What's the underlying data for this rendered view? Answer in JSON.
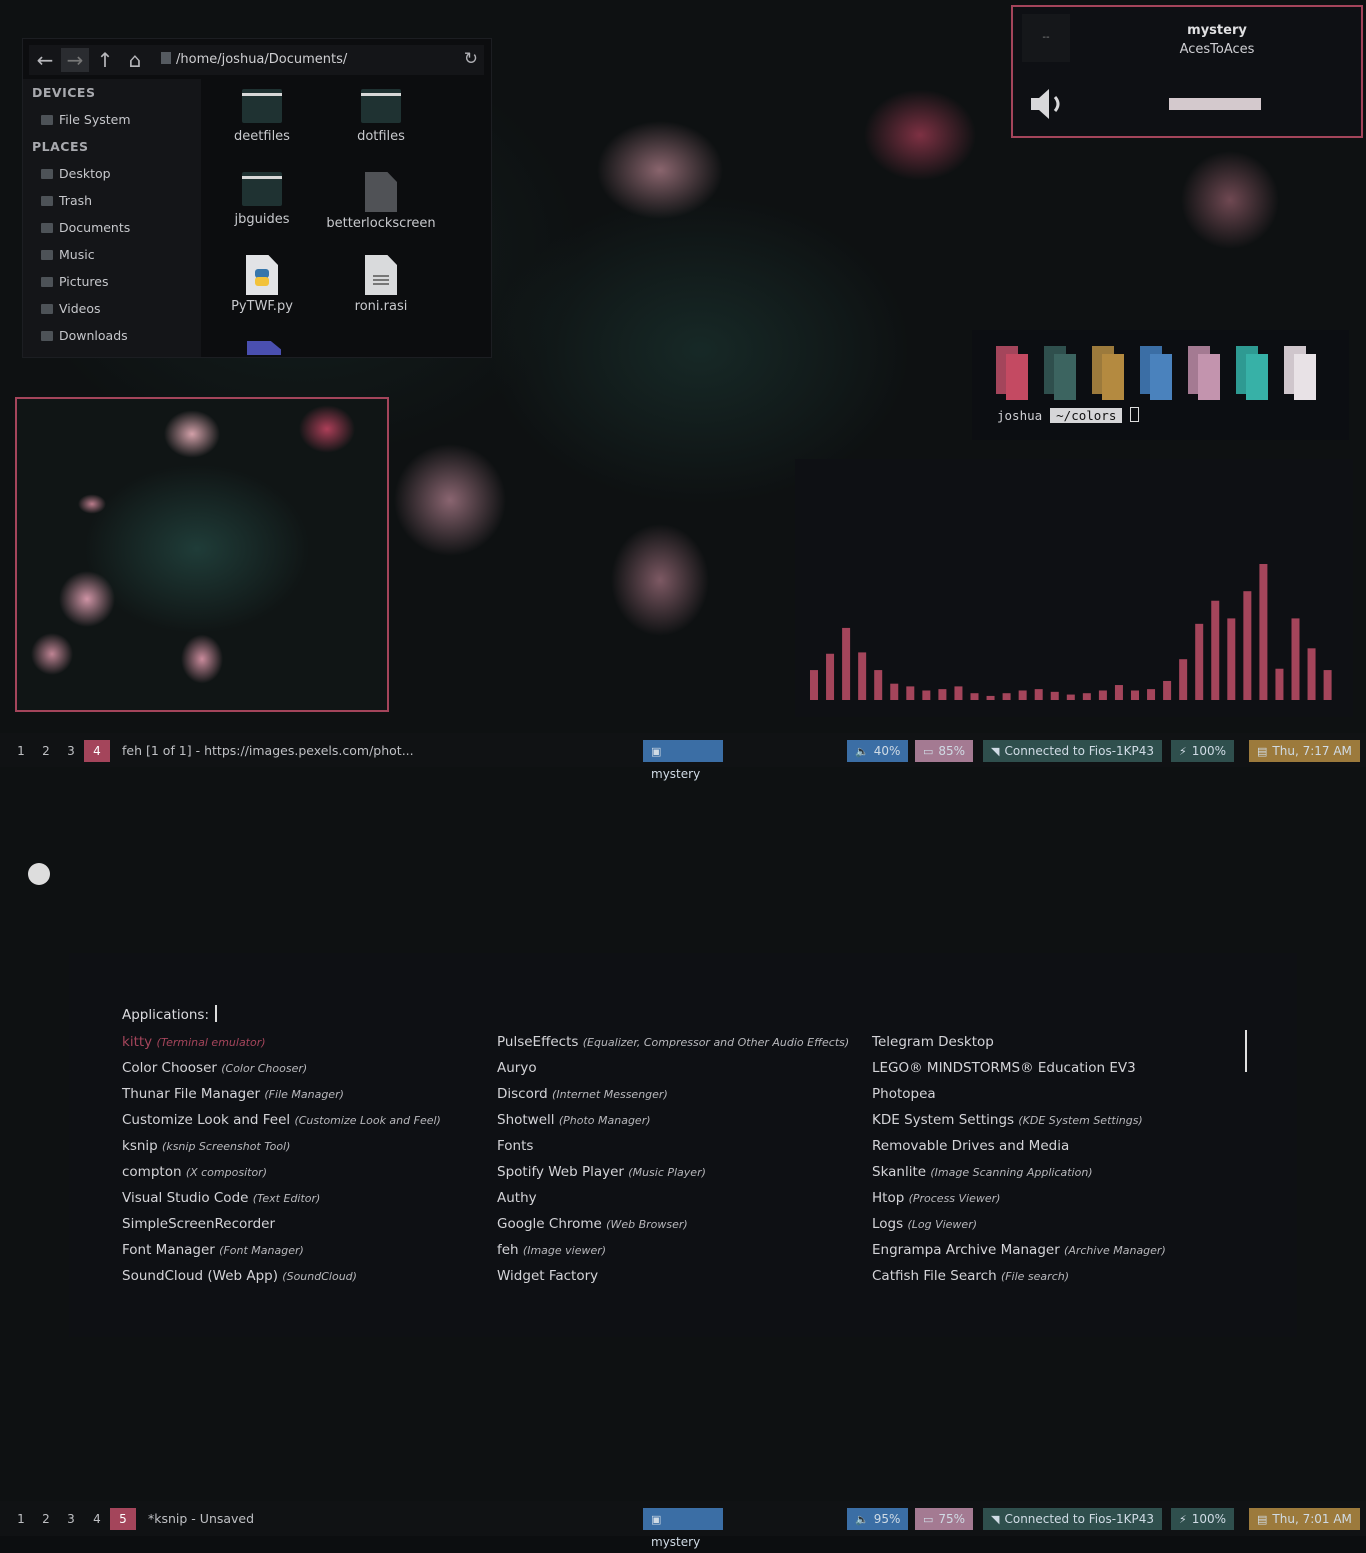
{
  "file_manager": {
    "path": "/home/joshua/Documents/",
    "sections": [
      {
        "title": "DEVICES",
        "items": [
          "File System"
        ]
      },
      {
        "title": "PLACES",
        "items": [
          "Desktop",
          "Trash",
          "Documents",
          "Music",
          "Pictures",
          "Videos",
          "Downloads"
        ]
      }
    ],
    "files": [
      {
        "name": "deetfiles",
        "type": "folder"
      },
      {
        "name": "dotfiles",
        "type": "folder"
      },
      {
        "name": "jbguides",
        "type": "folder"
      },
      {
        "name": "betterlockscreen",
        "type": "script"
      },
      {
        "name": "PyTWF.py",
        "type": "python"
      },
      {
        "name": "roni.rasi",
        "type": "text"
      }
    ]
  },
  "music_widget": {
    "cover_label": "--",
    "title": "mystery",
    "artist": "AcesToAces",
    "volume_icon": "speaker-icon"
  },
  "colors_terminal": {
    "swatches": [
      {
        "a": "#a4455b",
        "b": "#c44a62"
      },
      {
        "a": "#2f4f4d",
        "b": "#3c6460"
      },
      {
        "a": "#9c7a3c",
        "b": "#b48a40"
      },
      {
        "a": "#3b6ea5",
        "b": "#4a82bd"
      },
      {
        "a": "#a47a92",
        "b": "#c394ae"
      },
      {
        "a": "#2e9a92",
        "b": "#37b1a7"
      },
      {
        "a": "#cfc6cc",
        "b": "#e8e2e6"
      }
    ],
    "user": "joshua",
    "dir": "~/colors"
  },
  "visualizer": {
    "color": "#a4455b",
    "levels": [
      0.22,
      0.34,
      0.53,
      0.35,
      0.22,
      0.12,
      0.1,
      0.07,
      0.08,
      0.1,
      0.05,
      0.03,
      0.05,
      0.07,
      0.08,
      0.06,
      0.04,
      0.05,
      0.07,
      0.11,
      0.07,
      0.08,
      0.14,
      0.3,
      0.56,
      0.73,
      0.6,
      0.8,
      1.0,
      0.23,
      0.6,
      0.38,
      0.22
    ]
  },
  "top_bar": {
    "workspaces": [
      "1",
      "2",
      "3",
      "4"
    ],
    "active_workspace": "4",
    "window_title": "feh [1 of 1] - https://images.pexels.com/phot...",
    "music": "mystery",
    "volume": "40%",
    "memory": "85%",
    "wifi": "Connected to Fios-1KP43",
    "battery": "100%",
    "datetime": "Thu,  7:17 AM"
  },
  "bottom_bar": {
    "workspaces": [
      "1",
      "2",
      "3",
      "4",
      "5"
    ],
    "active_workspace": "5",
    "window_title": "*ksnip - Unsaved",
    "music": "mystery",
    "volume": "95%",
    "memory": "75%",
    "wifi": "Connected to Fios-1KP43",
    "battery": "100%",
    "datetime": "Thu,  7:01 AM"
  },
  "launcher": {
    "prompt": "Applications:",
    "columns": [
      [
        {
          "name": "kitty",
          "desc": "(Terminal emulator)"
        },
        {
          "name": "Color Chooser",
          "desc": "(Color Chooser)"
        },
        {
          "name": "Thunar File Manager",
          "desc": "(File Manager)"
        },
        {
          "name": "Customize Look and Feel",
          "desc": "(Customize Look and Feel)"
        },
        {
          "name": "ksnip",
          "desc": "(ksnip Screenshot Tool)"
        },
        {
          "name": "compton",
          "desc": "(X compositor)"
        },
        {
          "name": "Visual Studio Code",
          "desc": "(Text Editor)"
        },
        {
          "name": "SimpleScreenRecorder",
          "desc": ""
        },
        {
          "name": "Font Manager",
          "desc": "(Font Manager)"
        },
        {
          "name": "SoundCloud (Web App)",
          "desc": "(SoundCloud)"
        }
      ],
      [
        {
          "name": "PulseEffects",
          "desc": "(Equalizer, Compressor and Other Audio Effects)"
        },
        {
          "name": "Auryo",
          "desc": ""
        },
        {
          "name": "Discord",
          "desc": "(Internet Messenger)"
        },
        {
          "name": "Shotwell",
          "desc": "(Photo Manager)"
        },
        {
          "name": "Fonts",
          "desc": ""
        },
        {
          "name": "Spotify Web Player",
          "desc": "(Music Player)"
        },
        {
          "name": "Authy",
          "desc": ""
        },
        {
          "name": "Google Chrome",
          "desc": "(Web Browser)"
        },
        {
          "name": "feh",
          "desc": "(Image viewer)"
        },
        {
          "name": "Widget Factory",
          "desc": ""
        }
      ],
      [
        {
          "name": "Telegram Desktop",
          "desc": ""
        },
        {
          "name": "LEGO® MINDSTORMS® Education EV3",
          "desc": ""
        },
        {
          "name": "Photopea",
          "desc": ""
        },
        {
          "name": "KDE System Settings",
          "desc": "(KDE System Settings)"
        },
        {
          "name": "Removable Drives and Media",
          "desc": ""
        },
        {
          "name": "Skanlite",
          "desc": "(Image Scanning Application)"
        },
        {
          "name": "Htop",
          "desc": "(Process Viewer)"
        },
        {
          "name": "Logs",
          "desc": "(Log Viewer)"
        },
        {
          "name": "Engrampa Archive Manager",
          "desc": "(Archive Manager)"
        },
        {
          "name": "Catfish File Search",
          "desc": "(File search)"
        }
      ]
    ],
    "selected": "kitty"
  },
  "colors": {
    "accent": "#a4455b",
    "bar_bg": "#101214",
    "blue": "#3b6ea5",
    "mauve": "#a47a92",
    "teal": "#2f4f4d",
    "gold": "#9c7a3c"
  }
}
